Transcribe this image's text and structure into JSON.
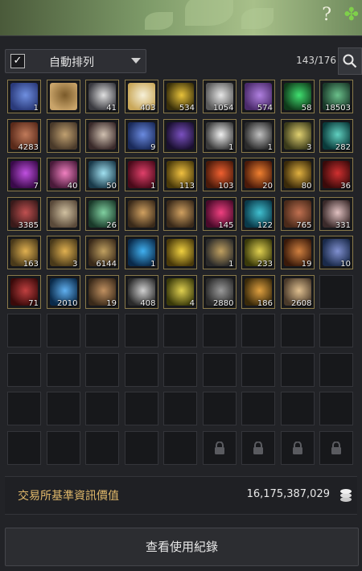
{
  "header": {
    "help_icon": "?",
    "clover_icon": "✤"
  },
  "toolbar": {
    "auto_sort_label": "自動排列",
    "auto_sort_checked": true,
    "capacity": "143/176"
  },
  "inventory": {
    "rows": [
      [
        {
          "name": "seashell",
          "qty": "1"
        },
        {
          "name": "anchor-scroll",
          "qty": ""
        },
        {
          "name": "feather",
          "qty": "41"
        },
        {
          "name": "sparkle-dust",
          "qty": "403"
        },
        {
          "name": "gold-fragment",
          "qty": "534"
        },
        {
          "name": "silver-ingot",
          "qty": "1054"
        },
        {
          "name": "purple-potion",
          "qty": "574"
        },
        {
          "name": "green-crystal",
          "qty": "58"
        },
        {
          "name": "pine-tree",
          "qty": "18503"
        }
      ],
      [
        {
          "name": "copper-ingot",
          "qty": "4283"
        },
        {
          "name": "treasure-pile",
          "qty": ""
        },
        {
          "name": "crafting-kit",
          "qty": ""
        },
        {
          "name": "blue-beast",
          "qty": "9"
        },
        {
          "name": "dark-crystal",
          "qty": ""
        },
        {
          "name": "white-horn",
          "qty": "1"
        },
        {
          "name": "pendant",
          "qty": "1"
        },
        {
          "name": "swirl-orb",
          "qty": "3"
        },
        {
          "name": "green-orb",
          "qty": "282"
        }
      ],
      [
        {
          "name": "violet-gem",
          "qty": "7"
        },
        {
          "name": "pink-crystal",
          "qty": "40"
        },
        {
          "name": "ice-shard",
          "qty": "50"
        },
        {
          "name": "ruby-shard",
          "qty": "1"
        },
        {
          "name": "gold-ore",
          "qty": "113"
        },
        {
          "name": "fire-gem",
          "qty": "103"
        },
        {
          "name": "flame-orb",
          "qty": "20"
        },
        {
          "name": "gold-amulet",
          "qty": "80"
        },
        {
          "name": "red-feather",
          "qty": "36"
        }
      ],
      [
        {
          "name": "red-ore",
          "qty": "3385"
        },
        {
          "name": "old-scroll",
          "qty": ""
        },
        {
          "name": "herb-bundle",
          "qty": "26"
        },
        {
          "name": "bell-fan",
          "qty": ""
        },
        {
          "name": "bell-fan-2",
          "qty": ""
        },
        {
          "name": "pink-pearl",
          "qty": "145"
        },
        {
          "name": "teal-pearl",
          "qty": "122"
        },
        {
          "name": "copper-coin",
          "qty": "765"
        },
        {
          "name": "flame-wisp",
          "qty": "331"
        }
      ],
      [
        {
          "name": "p-card",
          "qty": "163"
        },
        {
          "name": "p-card-2",
          "qty": "3"
        },
        {
          "name": "broom",
          "qty": "6144"
        },
        {
          "name": "blue-orb",
          "qty": "1"
        },
        {
          "name": "gold-ticket",
          "qty": ""
        },
        {
          "name": "scissors",
          "qty": "1"
        },
        {
          "name": "gold-leaf",
          "qty": "233"
        },
        {
          "name": "amber-frame",
          "qty": "19"
        },
        {
          "name": "blue-card",
          "qty": "10"
        }
      ],
      [
        {
          "name": "red-box",
          "qty": "71"
        },
        {
          "name": "blue-beam",
          "qty": "2010"
        },
        {
          "name": "bronze-key",
          "qty": "19"
        },
        {
          "name": "silver-key",
          "qty": "408"
        },
        {
          "name": "gold-key",
          "qty": "4"
        },
        {
          "name": "stone-totem",
          "qty": "2880"
        },
        {
          "name": "gold-mirror",
          "qty": "186"
        },
        {
          "name": "bread-coin",
          "qty": "2608"
        },
        {
          "name": "empty",
          "qty": ""
        }
      ]
    ],
    "empty_rows": 4,
    "locked_slots_last_row": 4
  },
  "footer": {
    "label": "交易所基準資訊價值",
    "value": "16,175,387,029"
  },
  "history_button": "查看使用紀錄",
  "colors": {
    "accent": "#e0b86a",
    "slot_border_filled": "#8a7a4a",
    "slot_bg": "#17181b",
    "panel_bg": "#222327"
  }
}
